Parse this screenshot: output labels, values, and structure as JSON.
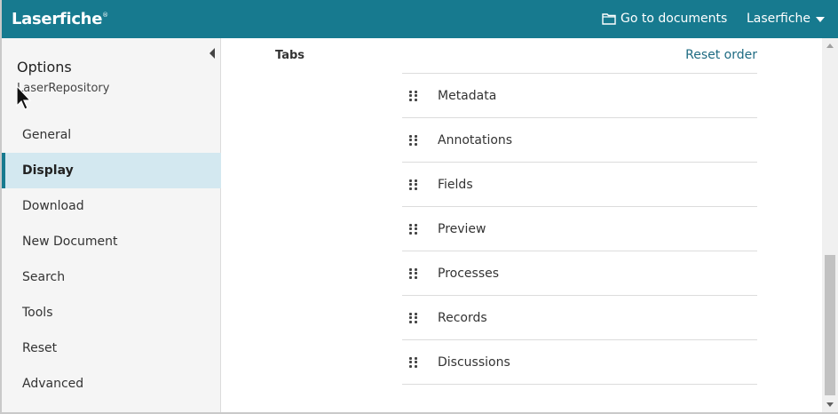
{
  "header": {
    "logo": "Laserfiche",
    "logo_mark": "®",
    "goto_label": "Go to documents",
    "user_label": "Laserfiche",
    "background": "#177a8f"
  },
  "sidebar": {
    "title": "Options",
    "repository": "LaserRepository",
    "items": [
      {
        "label": "General"
      },
      {
        "label": "Display"
      },
      {
        "label": "Download"
      },
      {
        "label": "New Document"
      },
      {
        "label": "Search"
      },
      {
        "label": "Tools"
      },
      {
        "label": "Reset"
      },
      {
        "label": "Advanced"
      }
    ],
    "active_item": "Display",
    "active_color": "#d3e8f0"
  },
  "main": {
    "section_label": "Tabs",
    "reset_label": "Reset order",
    "tabs": [
      {
        "label": "Metadata"
      },
      {
        "label": "Annotations"
      },
      {
        "label": "Fields"
      },
      {
        "label": "Preview"
      },
      {
        "label": "Processes"
      },
      {
        "label": "Records"
      },
      {
        "label": "Discussions"
      }
    ]
  },
  "icons": {
    "folder": "folder-icon",
    "caret": "chevron-down-icon",
    "collapse": "collapse-left-icon",
    "drag": "drag-handle-icon",
    "cursor": "mouse-pointer-icon"
  }
}
